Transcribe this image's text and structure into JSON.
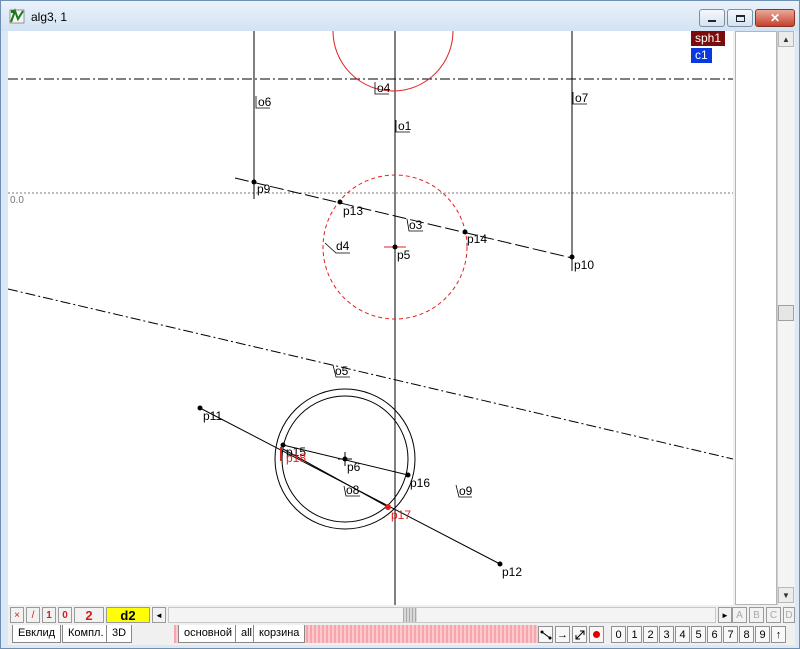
{
  "window": {
    "title": "alg3, 1",
    "app_icon": "app-logo-icon",
    "controls": {
      "minimize": "minimize-icon",
      "maximize": "maximize-icon",
      "close": "close-icon"
    }
  },
  "canvas": {
    "axis_label": "0.0",
    "labels": {
      "o1": "o1",
      "o3": "o3",
      "o4": "o4",
      "o5": "o5",
      "o6": "o6",
      "o7": "o7",
      "o8": "o8",
      "o9": "o9",
      "d4": "d4",
      "p5": "p5",
      "p6": "p6",
      "p9": "p9",
      "p10": "p10",
      "p11": "p11",
      "p12": "p12",
      "p13": "p13",
      "p14": "p14",
      "p15": "p15",
      "p16": "p16",
      "p17": "p17",
      "p18": "p18"
    },
    "colors": {
      "red": "#e02020",
      "black": "#000000",
      "grid": "#808080"
    }
  },
  "badges": {
    "sph1": {
      "label": "sph1",
      "color": "#7a0c0c"
    },
    "c1": {
      "label": "c1",
      "color": "#0a3adf"
    }
  },
  "toolbar": {
    "buttons": [
      {
        "name": "delete-tool",
        "label": "×",
        "color": "#d02020"
      },
      {
        "name": "line-tool",
        "label": "/",
        "color": "#d02020"
      },
      {
        "name": "one-tool",
        "label": "1",
        "color": "#d02020"
      },
      {
        "name": "zero-tool",
        "label": "0",
        "color": "#d02020"
      }
    ],
    "counter": "2",
    "active_object": "d2",
    "active_color": "#ffff00"
  },
  "scroll": {
    "left_arrow": "◄",
    "right_arrow": "►",
    "up_arrow": "▲",
    "down_arrow": "▼"
  },
  "view_letters": [
    "A",
    "B",
    "C",
    "D"
  ],
  "tabs": {
    "left": [
      "Евклид",
      "Компл.",
      "3D"
    ],
    "layers": [
      "основной",
      "all",
      "корзина"
    ]
  },
  "tools": {
    "connect": "connect-icon",
    "arrow": "→",
    "resize": "resize-icon",
    "dot": "record-dot-icon"
  },
  "digits": [
    "0",
    "1",
    "2",
    "3",
    "4",
    "5",
    "6",
    "7",
    "8",
    "9",
    "↑"
  ]
}
